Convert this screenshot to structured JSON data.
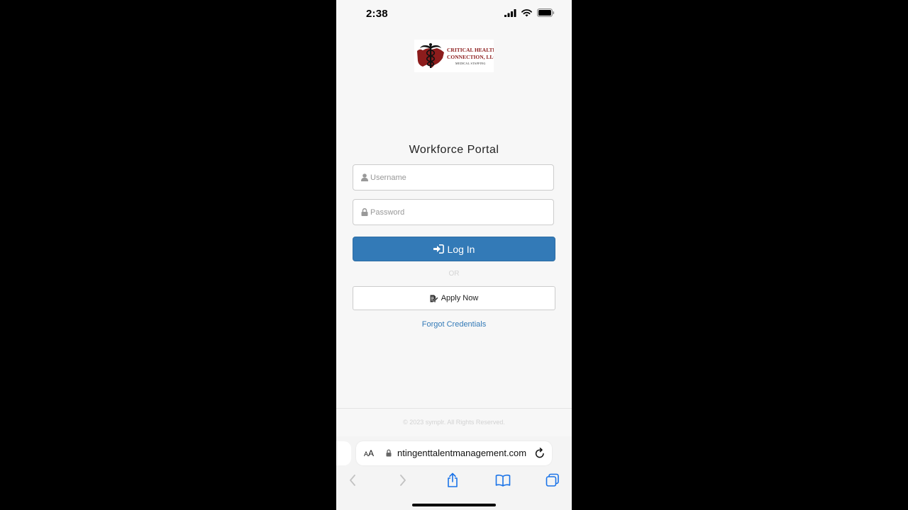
{
  "status_bar": {
    "time": "2:38"
  },
  "logo": {
    "line1": "CRITICAL HEALTH",
    "line2": "CONNECTION, LLC.",
    "line3": "MEDICAL STAFFING",
    "colors": {
      "brand_red": "#8c1c1c"
    }
  },
  "login": {
    "title": "Workforce Portal",
    "username_placeholder": "Username",
    "password_placeholder": "Password",
    "login_label": "Log In",
    "or_label": "OR",
    "apply_label": "Apply Now",
    "forgot_label": "Forgot Credentials"
  },
  "footer": {
    "copyright": "© 2023 symplr. All Rights Reserved."
  },
  "browser": {
    "text_size_label": "AA",
    "url": "ntingenttalentmanagement.com"
  },
  "colors": {
    "primary": "#337ab7",
    "background": "#f7f7f7"
  },
  "icons": {
    "user": "user-icon",
    "lock": "lock-icon",
    "login": "sign-in-icon",
    "apply": "edit-document-icon",
    "reload": "reload-icon",
    "back": "chevron-left-icon",
    "forward": "chevron-right-icon",
    "share": "share-icon",
    "bookmarks": "book-icon",
    "tabs": "tabs-icon"
  }
}
